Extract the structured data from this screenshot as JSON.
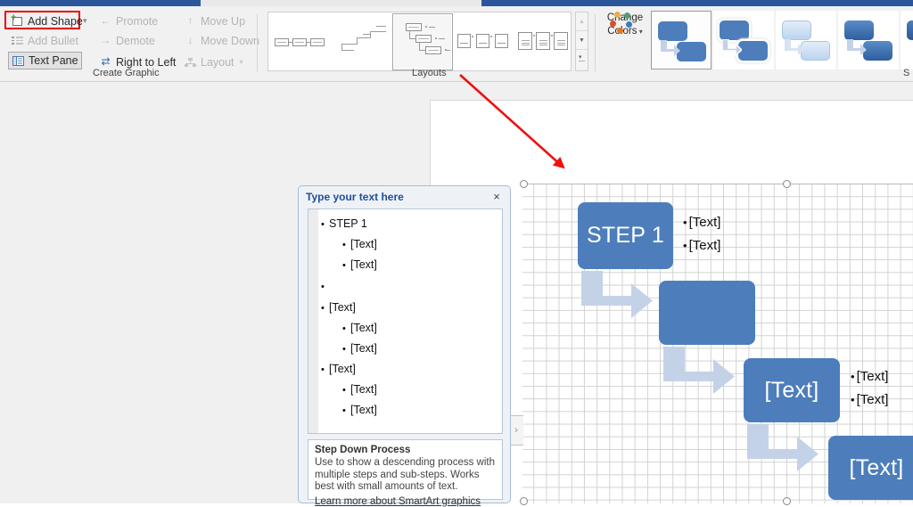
{
  "ribbon": {
    "create_graphic": {
      "group_label": "Create Graphic",
      "add_shape": "Add Shape",
      "add_bullet": "Add Bullet",
      "text_pane": "Text Pane",
      "promote": "Promote",
      "demote": "Demote",
      "right_to_left": "Right to Left",
      "layout": "Layout",
      "move_up": "Move Up",
      "move_down": "Move Down"
    },
    "layouts": {
      "group_label": "Layouts",
      "items": [
        {
          "name": "basic-chevron-process"
        },
        {
          "name": "descending-process"
        },
        {
          "name": "step-down-process"
        },
        {
          "name": "picture-accent-process"
        },
        {
          "name": "vertical-box-list"
        }
      ],
      "selected_index": 2,
      "scroll_up": "▲",
      "scroll_down": "▼",
      "more": "More"
    },
    "change_colors": {
      "line1": "Change",
      "line2": "Colors",
      "caret": "⌄",
      "dots": [
        "#e8b14a",
        "#4f9d78",
        "#d8502a",
        "#de7a22",
        "#3d7ebd"
      ]
    },
    "smartart_styles": {
      "group_label": "S",
      "selected_index": 0,
      "items": [
        {
          "name": "simple-fill"
        },
        {
          "name": "white-outline"
        },
        {
          "name": "subtle-effect"
        },
        {
          "name": "moderate-effect"
        },
        {
          "name": "intense-effect"
        }
      ]
    },
    "accent_color": "#2b579a"
  },
  "text_pane": {
    "title": "Type your text here",
    "close": "×",
    "rows": [
      {
        "level": 1,
        "text": "STEP 1"
      },
      {
        "level": 2,
        "text": "[Text]"
      },
      {
        "level": 2,
        "text": "[Text]"
      },
      {
        "level": 1,
        "text": ""
      },
      {
        "level": 1,
        "text": "[Text]"
      },
      {
        "level": 2,
        "text": "[Text]"
      },
      {
        "level": 2,
        "text": "[Text]"
      },
      {
        "level": 1,
        "text": "[Text]"
      },
      {
        "level": 2,
        "text": "[Text]"
      },
      {
        "level": 2,
        "text": "[Text]"
      }
    ],
    "description": {
      "title": "Step Down Process",
      "body": "Use to show a descending process with multiple steps and sub-steps. Works best with small amounts of text.",
      "link": "Learn more about SmartArt graphics"
    },
    "collapse_handle": "›"
  },
  "diagram": {
    "box_fill": "#4d7ebb",
    "arrow_fill": "#c4d2e8",
    "nodes": [
      {
        "label": "STEP 1",
        "bullets": [
          "[Text]",
          "[Text]"
        ]
      },
      {
        "label": "",
        "bullets": []
      },
      {
        "label": "[Text]",
        "bullets": [
          "[Text]",
          "[Text]"
        ]
      },
      {
        "label": "[Text]",
        "bullets": []
      }
    ],
    "bullet_char": "•"
  }
}
